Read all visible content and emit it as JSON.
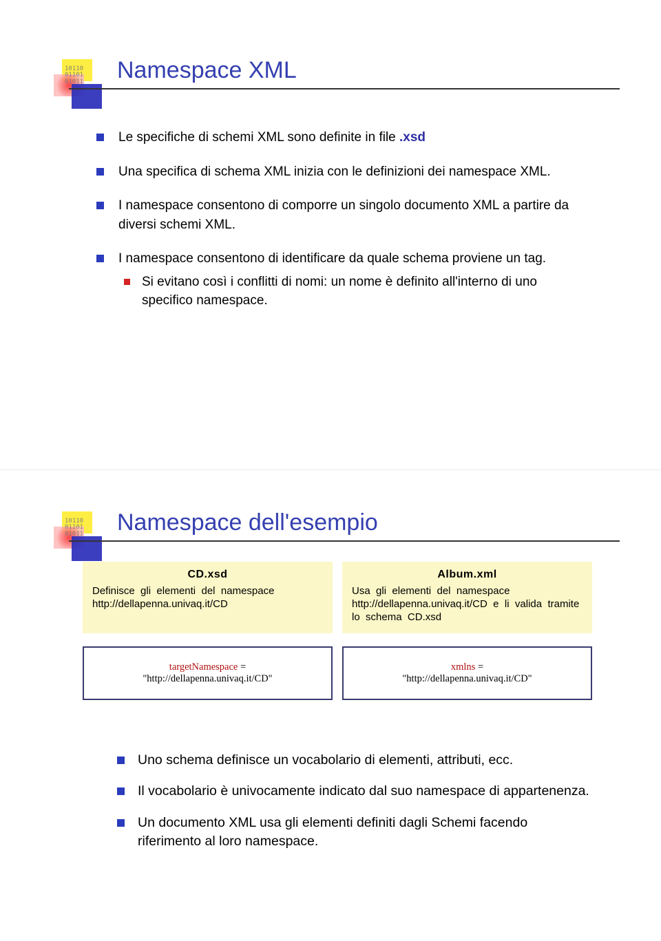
{
  "slide1": {
    "title": "Namespace XML",
    "bullets": {
      "b1_pre": "Le specifiche di schemi XML sono definite in file ",
      "b1_bold": ".xsd",
      "b2": "Una specifica di schema XML inizia con le definizioni dei namespace XML.",
      "b3": "I namespace consentono di comporre un singolo documento XML a partire da diversi schemi XML.",
      "b4": "I namespace consentono di identificare da quale schema proviene un tag.",
      "b4_sub": "Si evitano così i conflitti di nomi: un nome è definito all'interno di uno specifico namespace."
    }
  },
  "slide2": {
    "title": "Namespace dell'esempio",
    "box_left": {
      "header": "CD.xsd",
      "desc": "Definisce gli elementi del namespace http://dellapenna.univaq.it/CD"
    },
    "box_right": {
      "header": "Album.xml",
      "desc": "Usa gli elementi del namespace http://dellapenna.univaq.it/CD e li valida tramite lo schema CD.xsd"
    },
    "code_left": {
      "kw": "targetNamespace",
      "eq": " = ",
      "val": "\"http://dellapenna.univaq.it/CD\""
    },
    "code_right": {
      "kw": "xmlns",
      "eq": " = ",
      "val": "\"http://dellapenna.univaq.it/CD\""
    },
    "bullets": {
      "b1": "Uno schema definisce un vocabolario di elementi, attributi, ecc.",
      "b2": "Il vocabolario è univocamente indicato dal suo namespace di appartenenza.",
      "b3": "Un documento XML usa gli elementi definiti dagli Schemi facendo riferimento al loro namespace."
    }
  },
  "logo_digits": "10110\n01101\n01011"
}
